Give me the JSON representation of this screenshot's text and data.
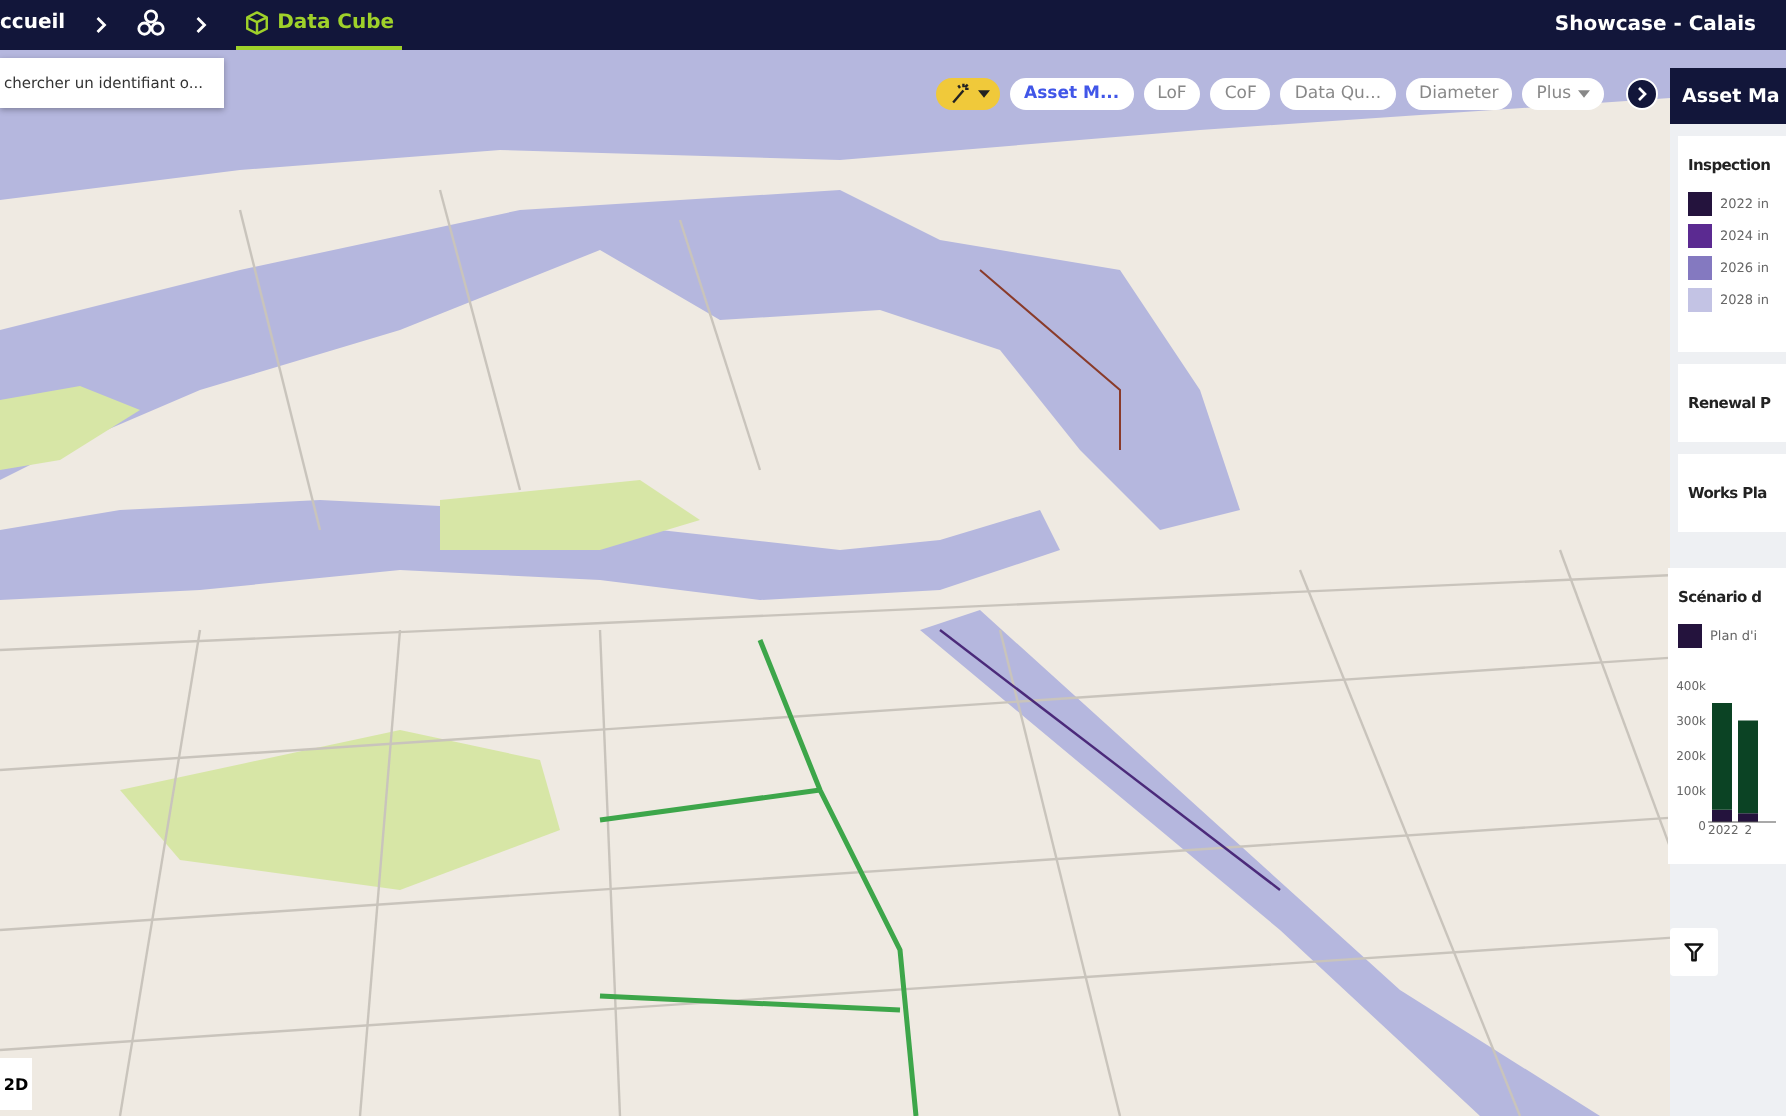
{
  "top_bar": {
    "breadcrumbs": [
      {
        "kind": "text",
        "label": "ccueil",
        "selected": false
      },
      {
        "kind": "icon",
        "selected": false
      },
      {
        "kind": "cube",
        "label": "Data Cube",
        "selected": true
      }
    ],
    "project": "Showcase - Calais"
  },
  "search": {
    "placeholder": "chercher un identifiant o..."
  },
  "toolbar": {
    "chips": [
      {
        "kind": "wand",
        "selected": false
      },
      {
        "kind": "chip",
        "label": "Asset M...",
        "selected": true
      },
      {
        "kind": "chip",
        "label": "LoF",
        "selected": false
      },
      {
        "kind": "chip",
        "label": "CoF",
        "selected": false
      },
      {
        "kind": "chip",
        "label": "Data Qu...",
        "selected": false
      },
      {
        "kind": "chip",
        "label": "Diameter",
        "selected": false
      },
      {
        "kind": "dropdown",
        "label": "Plus",
        "selected": false
      }
    ]
  },
  "panel": {
    "title": "Asset Ma",
    "cards": [
      {
        "kind": "legend",
        "title": "Inspection",
        "items": [
          {
            "label": "2022 in",
            "color": "#24133d"
          },
          {
            "label": "2024 in",
            "color": "#5b2a91"
          },
          {
            "label": "2026 in",
            "color": "#8479c0"
          },
          {
            "label": "2028 in",
            "color": "#c3c3e4"
          }
        ]
      },
      {
        "kind": "collapsed",
        "title": "Renewal P"
      },
      {
        "kind": "collapsed",
        "title": "Works Pla"
      },
      {
        "kind": "chart",
        "title": "Scénario d",
        "chart_data": {
          "type": "bar",
          "stacked": true,
          "categories": [
            "2022",
            "2"
          ],
          "yticks": [
            {
              "value": 0,
              "label": "0"
            },
            {
              "value": 100000,
              "label": "100k"
            },
            {
              "value": 200000,
              "label": "200k"
            },
            {
              "value": 300000,
              "label": "300k"
            },
            {
              "value": 400000,
              "label": "400k"
            }
          ],
          "ylim": [
            0,
            400000
          ],
          "series": [
            {
              "name": "Plan d'i",
              "color": "#24133d",
              "values": [
                35000,
                25000
              ]
            },
            {
              "color": "#0b4324",
              "values": [
                305000,
                265000
              ]
            }
          ]
        }
      }
    ]
  },
  "view_toggle": {
    "label": "2D"
  }
}
